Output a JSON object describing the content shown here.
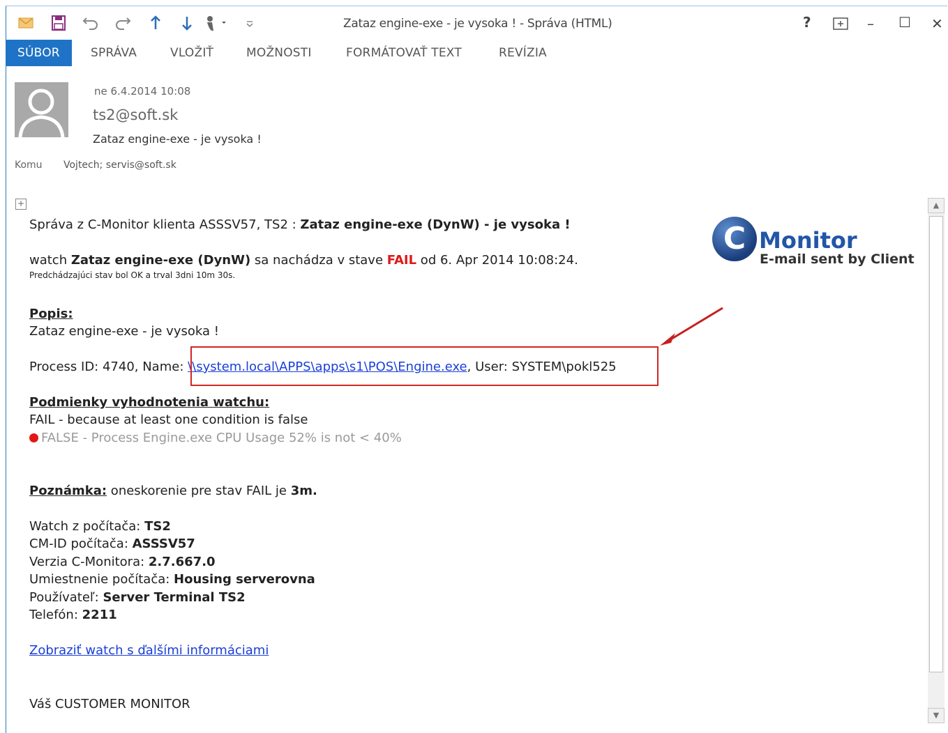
{
  "window": {
    "title": "Zataz engine-exe - je vysoka ! - Správa (HTML)",
    "help": "?",
    "restore_icon": "ribbon-display-icon",
    "minimize": "–",
    "maximize": "☐",
    "close": "✕"
  },
  "quick_access": [
    "mail-icon",
    "save-icon",
    "undo-icon",
    "redo-icon",
    "up-arrow-icon",
    "down-arrow-icon",
    "touch-mode-icon",
    "customize-icon"
  ],
  "tabs": [
    "SÚBOR",
    "SPRÁVA",
    "VLOŽIŤ",
    "MOŽNOSTI",
    "FORMÁTOVAŤ TEXT",
    "REVÍZIA"
  ],
  "header": {
    "date": "ne 6.4.2014 10:08",
    "from": "ts2@soft.sk",
    "subject": "Zataz engine-exe - je vysoka !",
    "to_label": "Komu",
    "to_value": "Vojtech; servis@soft.sk"
  },
  "body": {
    "intro_prefix": "Správa z C-Monitor klienta ASSSV57, TS2 : ",
    "intro_bold": "Zataz engine-exe (DynW) - je vysoka !",
    "watch_prefix": "watch ",
    "watch_name": "Zataz engine-exe (DynW)",
    "watch_mid": " sa nachádza v stave ",
    "watch_state": "FAIL",
    "watch_suffix": " od 6. Apr 2014 10:08:24.",
    "prev_state": "Predchádzajúci stav bol OK a trval 3dni 10m 30s.",
    "popis_heading": "Popis:",
    "popis_text": "Zataz engine-exe - je vysoka !",
    "process_prefix": "Process ID: 4740, Name: ",
    "process_link": "\\\\system.local\\APPS\\apps\\s1\\POS\\Engine.exe",
    "process_suffix": ", User: SYSTEM\\pokl525",
    "cond_heading": "Podmienky vyhodnotenia watchu:",
    "cond_result": "FAIL - because at least one condition is false",
    "cond_detail": "FALSE - Process Engine.exe CPU Usage 52% is not < 40%",
    "note_heading": "Poznámka:",
    "note_text": " oneskorenie pre stav FAIL je ",
    "note_value": "3m.",
    "info": [
      {
        "label": "Watch z počítača: ",
        "value": "TS2"
      },
      {
        "label": "CM-ID počítača: ",
        "value": "ASSSV57"
      },
      {
        "label": "Verzia C-Monitora: ",
        "value": "2.7.667.0"
      },
      {
        "label": "Umiestnenie počítača: ",
        "value": "Housing serverovna"
      },
      {
        "label": "Používateľ: ",
        "value": "Server Terminal TS2"
      },
      {
        "label": "Telefón: ",
        "value": "2211"
      }
    ],
    "more_link": "Zobraziť watch s ďalšími informáciami",
    "signature": "Váš CUSTOMER MONITOR"
  },
  "logo": {
    "letter": "C",
    "name": "Monitor",
    "tagline": "E-mail sent by Client"
  },
  "colors": {
    "accent": "#1f73c6",
    "fail": "#e01818",
    "link": "#1a3fd8",
    "annotation": "#d32525"
  }
}
